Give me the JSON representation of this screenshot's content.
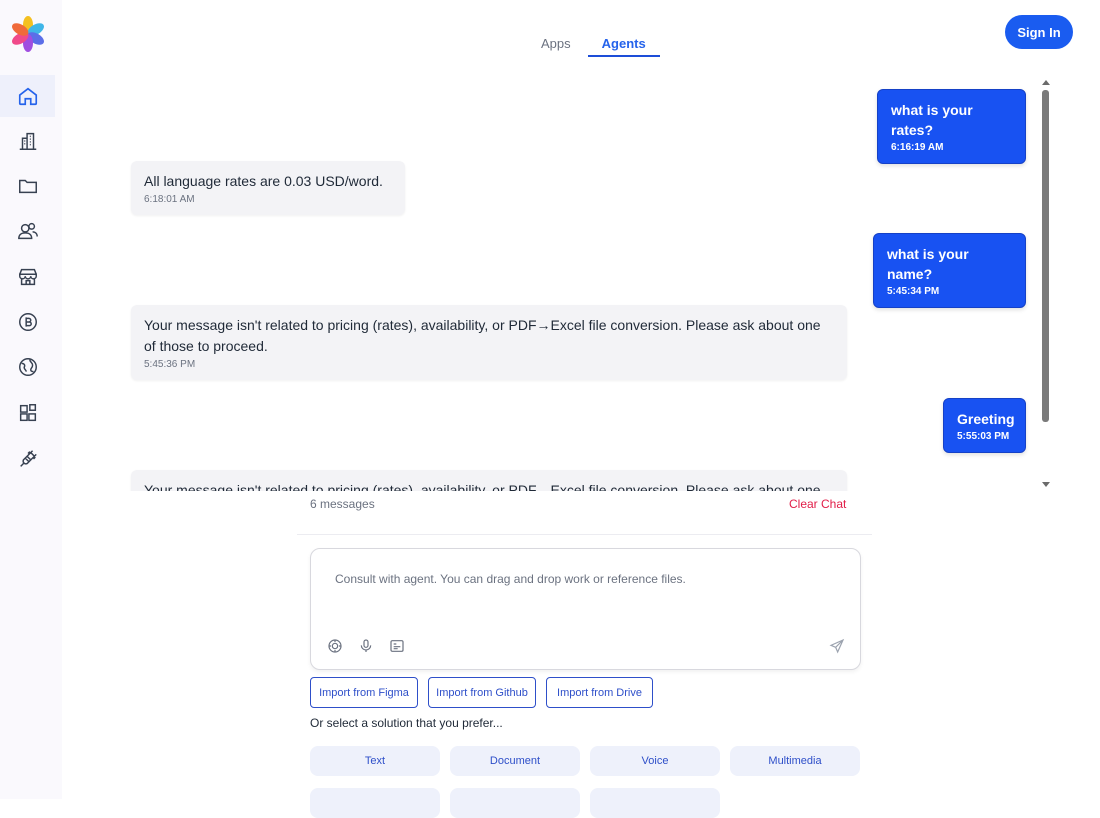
{
  "top_nav": {
    "tabs": [
      {
        "label": "Apps",
        "active": false
      },
      {
        "label": "Agents",
        "active": true
      }
    ],
    "sign_in": "Sign In"
  },
  "sidebar": {
    "items": [
      {
        "icon": "home-icon",
        "active": true
      },
      {
        "icon": "building-icon",
        "active": false
      },
      {
        "icon": "folder-icon",
        "active": false
      },
      {
        "icon": "users-icon",
        "active": false
      },
      {
        "icon": "store-icon",
        "active": false
      },
      {
        "icon": "bitcoin-icon",
        "active": false
      },
      {
        "icon": "globe-icon",
        "active": false
      },
      {
        "icon": "blocks-icon",
        "active": false
      },
      {
        "icon": "plug-icon",
        "active": false
      }
    ]
  },
  "messages": [
    {
      "role": "user",
      "text": "what is your rates?",
      "time": "6:16:19 AM"
    },
    {
      "role": "bot",
      "text": "All language rates are 0.03 USD/word.",
      "time": "6:18:01 AM"
    },
    {
      "role": "user",
      "text": "what is your name?",
      "time": "5:45:34 PM"
    },
    {
      "role": "bot",
      "text": "Your message isn't related to pricing (rates), availability, or PDF→Excel file conversion. Please ask about one of those to proceed.",
      "time": "5:45:36 PM"
    },
    {
      "role": "user",
      "text": "Greeting",
      "time": "5:55:03 PM"
    },
    {
      "role": "bot",
      "text": "Your message isn't related to pricing (rates), availability, or PDF→Excel file conversion. Please ask about one of those to proceed.",
      "time": ""
    }
  ],
  "chat_footer": {
    "count": "6 messages",
    "clear": "Clear Chat"
  },
  "composer": {
    "placeholder": "Consult with agent. You can drag and drop work or reference files.",
    "tools": [
      "target-icon",
      "microphone-icon",
      "image-icon"
    ],
    "send": "send-icon"
  },
  "imports": [
    "Import from Figma",
    "Import from Github",
    "Import from Drive"
  ],
  "prefer_label": "Or select a solution that you prefer...",
  "solutions": [
    "Text",
    "Document",
    "Voice",
    "Multimedia"
  ],
  "colors": {
    "accent": "#1852f2",
    "danger": "#e11d48",
    "link": "#2e4fc9"
  }
}
